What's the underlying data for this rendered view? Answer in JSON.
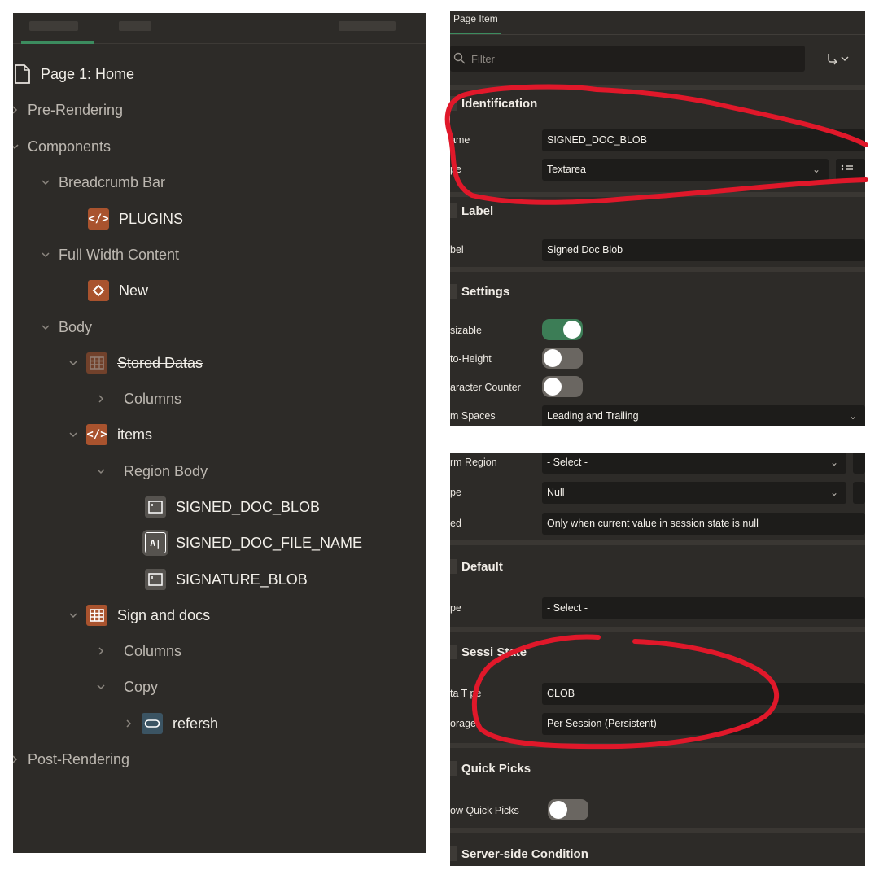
{
  "tree": {
    "page_title": "Page 1: Home",
    "pre_rendering": "Pre-Rendering",
    "components": "Components",
    "breadcrumb_bar": "Breadcrumb Bar",
    "plugins": "PLUGINS",
    "full_width_content": "Full Width Content",
    "new": "New",
    "body": "Body",
    "stored_datas": "Stored Datas",
    "columns_1": "Columns",
    "items": "items",
    "region_body": "Region Body",
    "item_1": "SIGNED_DOC_BLOB",
    "item_2": "SIGNED_DOC_FILE_NAME",
    "item_3": "SIGNATURE_BLOB",
    "sign_and_docs": "Sign and docs",
    "columns_2": "Columns",
    "copy": "Copy",
    "refersh": "refersh",
    "post_rendering": "Post-Rendering",
    "icons": {
      "code": "</>",
      "textfield": "A|"
    }
  },
  "property_editor": {
    "tab": "Page Item",
    "filter_placeholder": "Filter",
    "identification": {
      "title": "Identification",
      "name_label": "ame",
      "name_value": "SIGNED_DOC_BLOB",
      "type_label": "pe",
      "type_value": "Textarea"
    },
    "label": {
      "title": "Label",
      "label_label": "bel",
      "label_value": "Signed Doc Blob"
    },
    "settings": {
      "title": "Settings",
      "resizable_label": "sizable",
      "resizable_on": true,
      "auto_height_label": "to-Height",
      "auto_height_on": false,
      "char_counter_label": "aracter Counter",
      "char_counter_on": false,
      "trim_spaces_label": "m Spaces",
      "trim_spaces_value": "Leading and Trailing"
    },
    "source": {
      "form_region_label": "rm Region",
      "form_region_value": "- Select -",
      "type_label": "pe",
      "type_value": "Null",
      "used_label": "ed",
      "used_value": "Only when current value in session state is null"
    },
    "default": {
      "title": "Default",
      "type_label": "pe",
      "type_value": "- Select -"
    },
    "session_state": {
      "title": "Sessi  State",
      "data_type_label": "ta T  pe",
      "data_type_value": "CLOB",
      "storage_label": "orage",
      "storage_value": "Per Session (Persistent)"
    },
    "quick_picks": {
      "title": "Quick Picks",
      "show_label": "ow Quick Picks",
      "show_on": false
    },
    "server_side": {
      "title": "Server-side Condition"
    }
  },
  "colors": {
    "panel_bg": "#2d2b28",
    "field_bg": "#1d1c1a",
    "accent_green": "#3c8c5f",
    "icon_orange": "#a9532e",
    "annotation_red": "#e0182a"
  }
}
